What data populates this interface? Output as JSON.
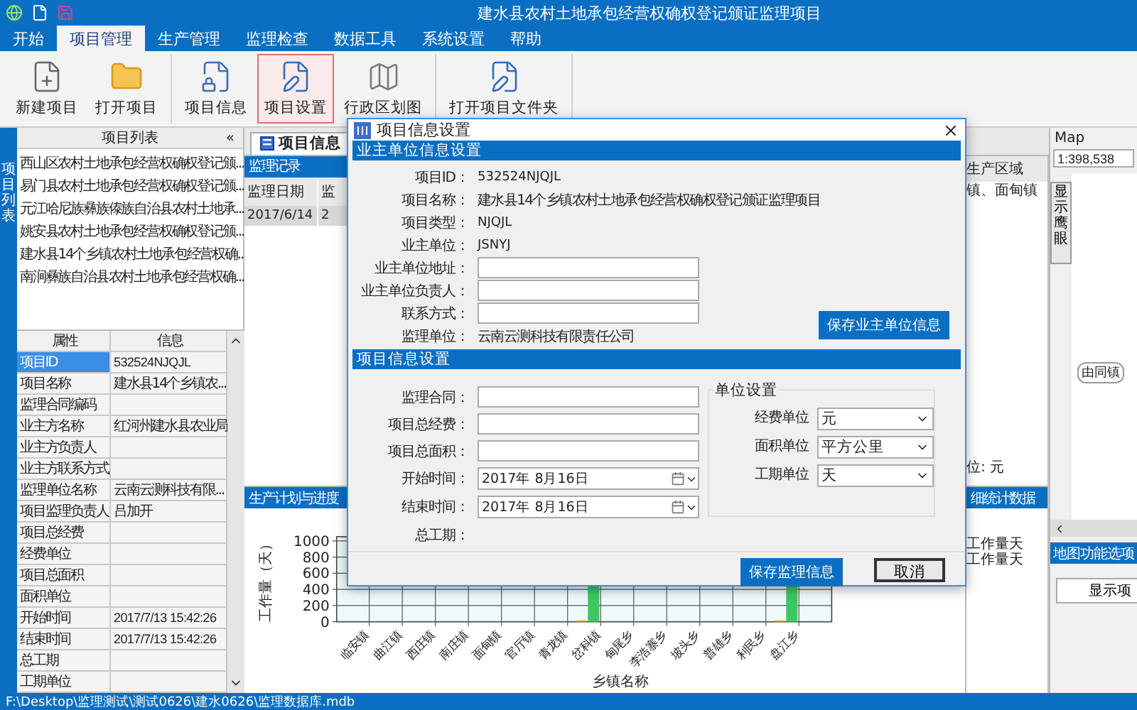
{
  "title_bar": {
    "title": "建水县农村土地承包经营权确权登记颁证监理项目"
  },
  "ribbon": {
    "tabs": [
      {
        "label": "开始",
        "selected": false
      },
      {
        "label": "项目管理",
        "selected": true
      },
      {
        "label": "生产管理",
        "selected": false
      },
      {
        "label": "监理检查",
        "selected": false
      },
      {
        "label": "数据工具",
        "selected": false
      },
      {
        "label": "系统设置",
        "selected": false
      },
      {
        "label": "帮助",
        "selected": false
      }
    ],
    "groups": [
      [
        {
          "label": "新建项目",
          "kind": "new",
          "selected": false
        },
        {
          "label": "打开项目",
          "kind": "open",
          "selected": false
        }
      ],
      [
        {
          "label": "项目信息",
          "kind": "info",
          "selected": false
        },
        {
          "label": "项目设置",
          "kind": "edit",
          "selected": true
        },
        {
          "label": "行政区划图",
          "kind": "map",
          "selected": false
        }
      ],
      [
        {
          "label": "打开项目文件夹",
          "kind": "edit",
          "selected": false
        }
      ]
    ]
  },
  "project_list": {
    "side_tab": "项目列表",
    "title": "项目列表",
    "collapse": "«",
    "items": [
      "西山区农村土地承包经营权确权登记颁...",
      "易门县农村土地承包经营权确权登记颁...",
      "元江哈尼族彝族傣族自治县农村土地承...",
      "姚安县农村土地承包经营权确权登记颁...",
      "建水县14个乡镇农村土地承包经营权确...",
      "南涧彝族自治县农村土地承包经营权确..."
    ]
  },
  "properties": {
    "columns": [
      "属性",
      "信息"
    ],
    "rows": [
      {
        "name": "项目ID",
        "value": "532524NJQJL",
        "selected": true
      },
      {
        "name": "项目名称",
        "value": "建水县14个乡镇农...",
        "selected": false
      },
      {
        "name": "监理合同编码",
        "selected": false
      },
      {
        "name": "业主方名称",
        "value": "红河州建水县农业局",
        "selected": false
      },
      {
        "name": "业主方负责人",
        "selected": false
      },
      {
        "name": "业主方联系方式",
        "selected": false
      },
      {
        "name": "监理单位名称",
        "value": "云南云测科技有限...",
        "selected": false
      },
      {
        "name": "项目监理负责人",
        "value": "吕加开",
        "selected": false
      },
      {
        "name": "项目总经费",
        "selected": false
      },
      {
        "name": "经费单位",
        "selected": false
      },
      {
        "name": "项目总面积",
        "selected": false
      },
      {
        "name": "面积单位",
        "selected": false
      },
      {
        "name": "开始时间",
        "value": "2017/7/13 15:42:26",
        "selected": false
      },
      {
        "name": "结束时间",
        "value": "2017/7/13 15:42:26",
        "selected": false
      },
      {
        "name": "总工期",
        "selected": false
      },
      {
        "name": "工期单位",
        "selected": false
      }
    ]
  },
  "workspace": {
    "tab": "项目信息",
    "records": {
      "title": "监理记录",
      "columns": [
        "监理日期",
        "监"
      ],
      "rows": [
        [
          "2017/6/14",
          "2"
        ]
      ]
    },
    "region": {
      "heading": "生产区域",
      "cell": "镇、面甸镇",
      "note": "位: 元"
    },
    "progress": {
      "title": "生产计划与进度",
      "ylabel": "工作量（天）",
      "xlabel": "乡镇名称",
      "tick_labels": [
        "1000",
        "800",
        "600",
        "400",
        "200",
        "0"
      ],
      "categories": [
        {
          "label": "临安镇",
          "kind": "flat"
        },
        {
          "label": "曲江镇",
          "kind": "flat"
        },
        {
          "label": "西庄镇",
          "kind": "flat"
        },
        {
          "label": "南庄镇",
          "kind": "flat"
        },
        {
          "label": "面甸镇",
          "kind": "flat"
        },
        {
          "label": "官厅镇",
          "kind": "flat"
        },
        {
          "label": "青龙镇",
          "kind": "flat"
        },
        {
          "label": "岔科镇",
          "kind": "tall"
        },
        {
          "label": "甸尾乡",
          "kind": "flat"
        },
        {
          "label": "李浩寨乡",
          "kind": "flat"
        },
        {
          "label": "坡头乡",
          "kind": "flat"
        },
        {
          "label": "普雄乡",
          "kind": "flat"
        },
        {
          "label": "利民乡",
          "kind": "flat"
        },
        {
          "label": "盘江乡",
          "kind": "tall"
        }
      ]
    },
    "stats": {
      "title": "细统计数据",
      "legend": [
        "工作量天",
        "工作量天"
      ]
    }
  },
  "map": {
    "title": "Map",
    "scale": "1:398,538",
    "eagle_eye": "显示鹰眼",
    "place": "由同镇",
    "options_title": "地图功能选项",
    "show_button": "显示项"
  },
  "dialog": {
    "title": "项目信息设置",
    "owner_section": "业主单位信息设置",
    "owner_rows": [
      {
        "label": "项目ID：",
        "kind": "text",
        "value": "532524NJQJL"
      },
      {
        "label": "项目名称：",
        "kind": "text",
        "value": "建水县14个乡镇农村土地承包经营权确权登记颁证监理项目"
      },
      {
        "label": "项目类型：",
        "kind": "text",
        "value": "NJQJL"
      },
      {
        "label": "业主单位：",
        "kind": "text",
        "value": "JSNYJ"
      },
      {
        "label": "业主单位地址：",
        "kind": "input"
      },
      {
        "label": "业主单位负责人：",
        "kind": "input"
      },
      {
        "label": "联系方式：",
        "kind": "input"
      },
      {
        "label": "监理单位：",
        "kind": "text",
        "value": "云南云测科技有限责任公司"
      }
    ],
    "save_owner": "保存业主单位信息",
    "project_section": "项目信息设置",
    "project_rows": [
      {
        "label": "监理合同：",
        "kind": "input"
      },
      {
        "label": "项目总经费：",
        "kind": "input"
      },
      {
        "label": "项目总面积：",
        "kind": "input"
      },
      {
        "label": "开始时间：",
        "kind": "date",
        "value": "2017年  8月16日"
      },
      {
        "label": "结束时间：",
        "kind": "date",
        "value": "2017年  8月16日"
      },
      {
        "label": "总工期：",
        "kind": "text"
      }
    ],
    "units": {
      "title": "单位设置",
      "rows": [
        {
          "label": "经费单位",
          "value": "元"
        },
        {
          "label": "面积单位",
          "value": "平方公里"
        },
        {
          "label": "工期单位",
          "value": "天"
        }
      ]
    },
    "save_project": "保存监理信息",
    "cancel": "取消"
  },
  "status_bar": {
    "path": "F:\\Desktop\\监理测试\\测试0626\\建水0626\\监理数据库.mdb"
  }
}
